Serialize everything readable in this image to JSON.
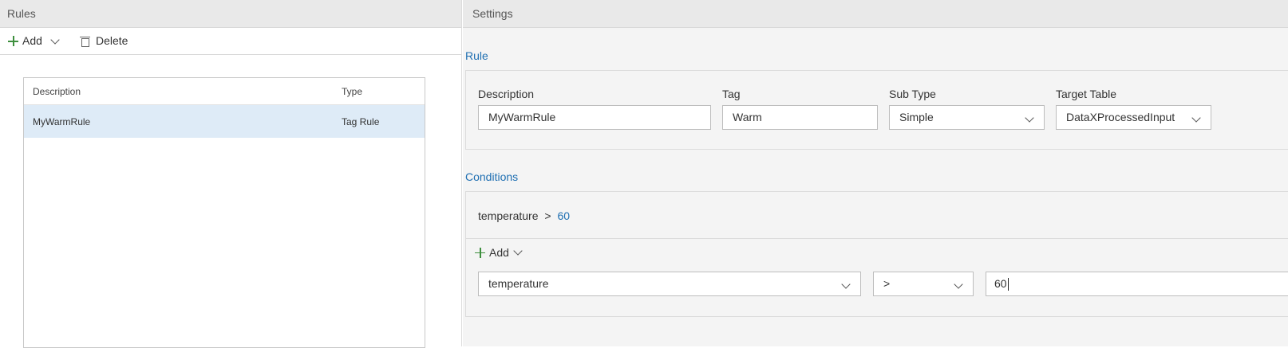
{
  "rules_pane": {
    "title": "Rules",
    "toolbar": {
      "add_label": "Add",
      "delete_label": "Delete"
    },
    "table": {
      "columns": [
        "Description",
        "Type"
      ],
      "rows": [
        {
          "description": "MyWarmRule",
          "type": "Tag Rule",
          "selected": true
        }
      ]
    }
  },
  "settings_pane": {
    "title": "Settings",
    "rule_section": {
      "title": "Rule",
      "description_label": "Description",
      "description_value": "MyWarmRule",
      "tag_label": "Tag",
      "tag_value": "Warm",
      "subtype_label": "Sub Type",
      "subtype_value": "Simple",
      "target_table_label": "Target Table",
      "target_table_value": "DataXProcessedInput"
    },
    "conditions_section": {
      "title": "Conditions",
      "summary_field": "temperature",
      "summary_operator": ">",
      "summary_value": "60",
      "add_label": "Add",
      "field_value": "temperature",
      "operator_value": ">",
      "value_input": "60"
    }
  },
  "colors": {
    "accent": "#1f6fb2",
    "selected_row": "#deebf7",
    "add_icon": "#3e8f3e",
    "settings_bg": "#f4f4f4"
  },
  "icons": [
    "plus-icon",
    "chevron-down-icon",
    "trash-icon"
  ]
}
